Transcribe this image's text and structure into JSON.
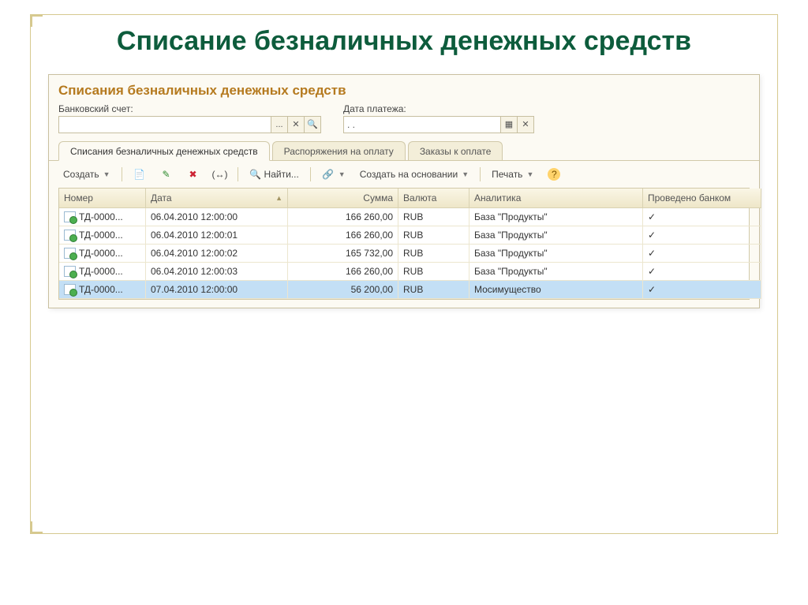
{
  "slide_title": "Списание безналичных денежных средств",
  "window_title": "Списания безналичных денежных средств",
  "filters": {
    "account_label": "Банковский счет:",
    "account_value": "",
    "date_label": "Дата платежа:",
    "date_value": ". ."
  },
  "buttons": {
    "ellipsis": "...",
    "clear": "✕",
    "search": "🔍",
    "calendar": "▦"
  },
  "tabs": [
    {
      "label": "Списания безналичных денежных средств"
    },
    {
      "label": "Распоряжения на оплату"
    },
    {
      "label": "Заказы к оплате"
    }
  ],
  "toolbar": {
    "create": "Создать",
    "find": "Найти...",
    "create_based": "Создать на основании",
    "print": "Печать"
  },
  "columns": {
    "number": "Номер",
    "date": "Дата",
    "sum": "Сумма",
    "currency": "Валюта",
    "analytics": "Аналитика",
    "bank": "Проведено банком"
  },
  "rows": [
    {
      "number": "ТД-0000...",
      "date": "06.04.2010 12:00:00",
      "sum": "166 260,00",
      "currency": "RUB",
      "analytics": "База \"Продукты\"",
      "bank": "✓"
    },
    {
      "number": "ТД-0000...",
      "date": "06.04.2010 12:00:01",
      "sum": "166 260,00",
      "currency": "RUB",
      "analytics": "База \"Продукты\"",
      "bank": "✓"
    },
    {
      "number": "ТД-0000...",
      "date": "06.04.2010 12:00:02",
      "sum": "165 732,00",
      "currency": "RUB",
      "analytics": "База \"Продукты\"",
      "bank": "✓"
    },
    {
      "number": "ТД-0000...",
      "date": "06.04.2010 12:00:03",
      "sum": "166 260,00",
      "currency": "RUB",
      "analytics": "База \"Продукты\"",
      "bank": "✓"
    },
    {
      "number": "ТД-0000...",
      "date": "07.04.2010 12:00:00",
      "sum": "56 200,00",
      "currency": "RUB",
      "analytics": "Мосимущество",
      "bank": "✓",
      "selected": true
    }
  ]
}
